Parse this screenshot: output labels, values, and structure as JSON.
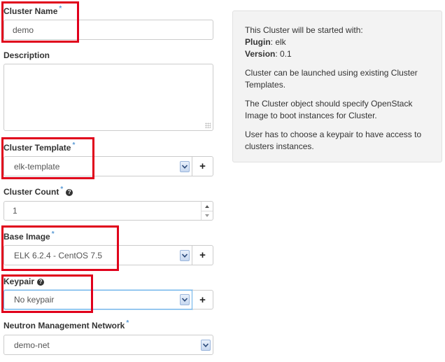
{
  "form": {
    "cluster_name": {
      "label": "Cluster Name",
      "value": "demo"
    },
    "description": {
      "label": "Description",
      "value": ""
    },
    "cluster_template": {
      "label": "Cluster Template",
      "value": "elk-template",
      "add": "+"
    },
    "cluster_count": {
      "label": "Cluster Count",
      "value": "1",
      "help": "?"
    },
    "base_image": {
      "label": "Base Image",
      "value": "ELK 6.2.4 - CentOS 7.5",
      "add": "+"
    },
    "keypair": {
      "label": "Keypair",
      "value": "No keypair",
      "add": "+",
      "help": "?"
    },
    "neutron_network": {
      "label": "Neutron Management Network",
      "value": "demo-net"
    },
    "required_mark": "*"
  },
  "info": {
    "started_with": "This Cluster will be started with:",
    "plugin_label": "Plugin",
    "plugin_value": ": elk",
    "version_label": "Version",
    "version_value": ": 0.1",
    "p_templates": "Cluster can be launched using existing Cluster Templates.",
    "p_image": "The Cluster object should specify OpenStack Image to boot instances for Cluster.",
    "p_keypair": "User has to choose a keypair to have access to clusters instances."
  },
  "colors": {
    "highlight": "#e0001b",
    "required": "#5b9bd5",
    "focus": "#66afe9"
  },
  "icons": {
    "select": "chevron-down-icon",
    "add": "plus-icon",
    "help": "question-circle-icon",
    "spinner": "spinner-arrows-icon"
  }
}
